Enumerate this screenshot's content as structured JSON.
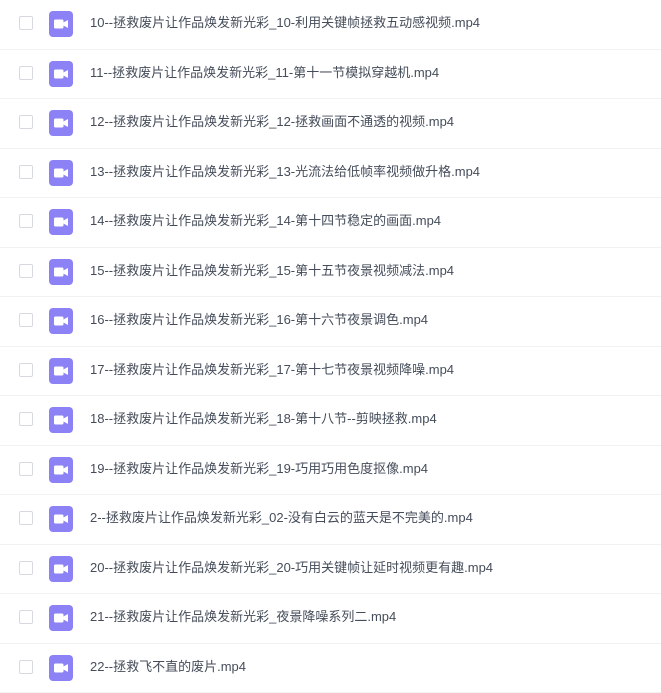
{
  "colors": {
    "icon_bg": "#8c82f6",
    "icon_fg": "#ffffff",
    "text": "#454d5a",
    "checkbox_border": "#d6d9df",
    "row_divider": "#f1f2f4"
  },
  "files": [
    {
      "name": "10--拯救废片让作品焕发新光彩_10-利用关键帧拯救五动感视频.mp4",
      "icon": "video-file-icon"
    },
    {
      "name": "11--拯救废片让作品焕发新光彩_11-第十一节模拟穿越机.mp4",
      "icon": "video-file-icon"
    },
    {
      "name": "12--拯救废片让作品焕发新光彩_12-拯救画面不通透的视频.mp4",
      "icon": "video-file-icon"
    },
    {
      "name": "13--拯救废片让作品焕发新光彩_13-光流法给低帧率视频做升格.mp4",
      "icon": "video-file-icon"
    },
    {
      "name": "14--拯救废片让作品焕发新光彩_14-第十四节稳定的画面.mp4",
      "icon": "video-file-icon"
    },
    {
      "name": "15--拯救废片让作品焕发新光彩_15-第十五节夜景视频减法.mp4",
      "icon": "video-file-icon"
    },
    {
      "name": "16--拯救废片让作品焕发新光彩_16-第十六节夜景调色.mp4",
      "icon": "video-file-icon"
    },
    {
      "name": "17--拯救废片让作品焕发新光彩_17-第十七节夜景视频降噪.mp4",
      "icon": "video-file-icon"
    },
    {
      "name": "18--拯救废片让作品焕发新光彩_18-第十八节--剪映拯救.mp4",
      "icon": "video-file-icon"
    },
    {
      "name": "19--拯救废片让作品焕发新光彩_19-巧用巧用色度抠像.mp4",
      "icon": "video-file-icon"
    },
    {
      "name": "2--拯救废片让作品焕发新光彩_02-没有白云的蓝天是不完美的.mp4",
      "icon": "video-file-icon"
    },
    {
      "name": "20--拯救废片让作品焕发新光彩_20-巧用关键帧让延时视频更有趣.mp4",
      "icon": "video-file-icon"
    },
    {
      "name": "21--拯救废片让作品焕发新光彩_夜景降噪系列二.mp4",
      "icon": "video-file-icon"
    },
    {
      "name": "22--拯救飞不直的废片.mp4",
      "icon": "video-file-icon"
    }
  ]
}
